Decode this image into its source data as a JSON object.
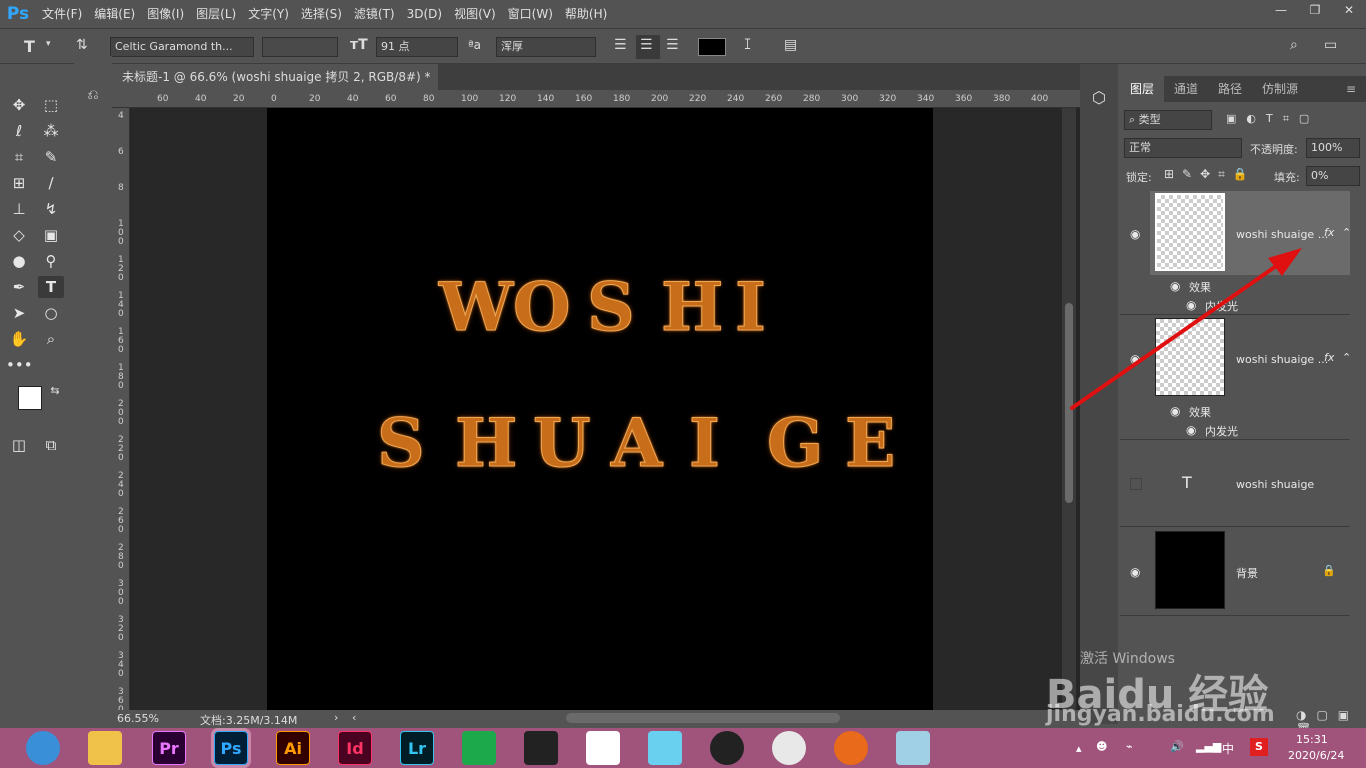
{
  "app": {
    "logo": "Ps"
  },
  "menus": [
    "文件(F)",
    "编辑(E)",
    "图像(I)",
    "图层(L)",
    "文字(Y)",
    "选择(S)",
    "滤镜(T)",
    "3D(D)",
    "视图(V)",
    "窗口(W)",
    "帮助(H)"
  ],
  "window_controls": {
    "minimize": "—",
    "restore": "❐",
    "close": "✕"
  },
  "options": {
    "tool_label": "T",
    "font_family": "Celtic Garamond th...",
    "font_size": "91 点",
    "antialias_label": "ªa",
    "antialias": "浑厚",
    "color": "#000000"
  },
  "document": {
    "tab_title": "未标题-1 @ 66.6% (woshi shuaige 拷贝 2, RGB/8#) *",
    "line1": "WOSHI",
    "line2": "SHUAIGE",
    "zoom": "66.55%",
    "doc_info": "文档:3.25M/3.14M"
  },
  "ruler_h": [
    "60",
    "40",
    "20",
    "0",
    "20",
    "40",
    "60",
    "80",
    "100",
    "120",
    "140",
    "160",
    "180",
    "200",
    "220",
    "240",
    "260",
    "280",
    "300",
    "320",
    "340",
    "360",
    "380",
    "400"
  ],
  "ruler_v": [
    "4",
    "6",
    "8",
    "1 0 0",
    "1 2 0",
    "1 4 0",
    "1 6 0",
    "1 8 0",
    "2 0 0",
    "2 2 0",
    "2 4 0",
    "2 6 0",
    "2 8 0",
    "3 0 0",
    "3 2 0",
    "3 4 0",
    "3 6 0"
  ],
  "layers_panel": {
    "tabs": [
      "图层",
      "通道",
      "路径",
      "仿制源"
    ],
    "filter_kind": "类型",
    "blend_mode": "正常",
    "opacity_label": "不透明度:",
    "opacity": "100%",
    "lock_label": "锁定:",
    "fill_label": "填充:",
    "fill": "0%",
    "layers": [
      {
        "name": "woshi shuaige ...",
        "fx": "fx",
        "effects": "效果",
        "effect_item": "内发光"
      },
      {
        "name": "woshi shuaige ...",
        "fx": "fx",
        "effects": "效果",
        "effect_item": "内发光"
      },
      {
        "name": "woshi shuaige",
        "type_icon": "T"
      },
      {
        "name": "背景"
      }
    ]
  },
  "watermark": {
    "brand": "Baidu 经验",
    "url": "jingyan.baidu.com",
    "activate": "激活 Windows"
  },
  "taskbar": {
    "apps": [
      "Pr",
      "Ps",
      "Ai",
      "Id",
      "Lr"
    ],
    "time": "15:31",
    "date": "2020/6/24",
    "ime": "中"
  }
}
